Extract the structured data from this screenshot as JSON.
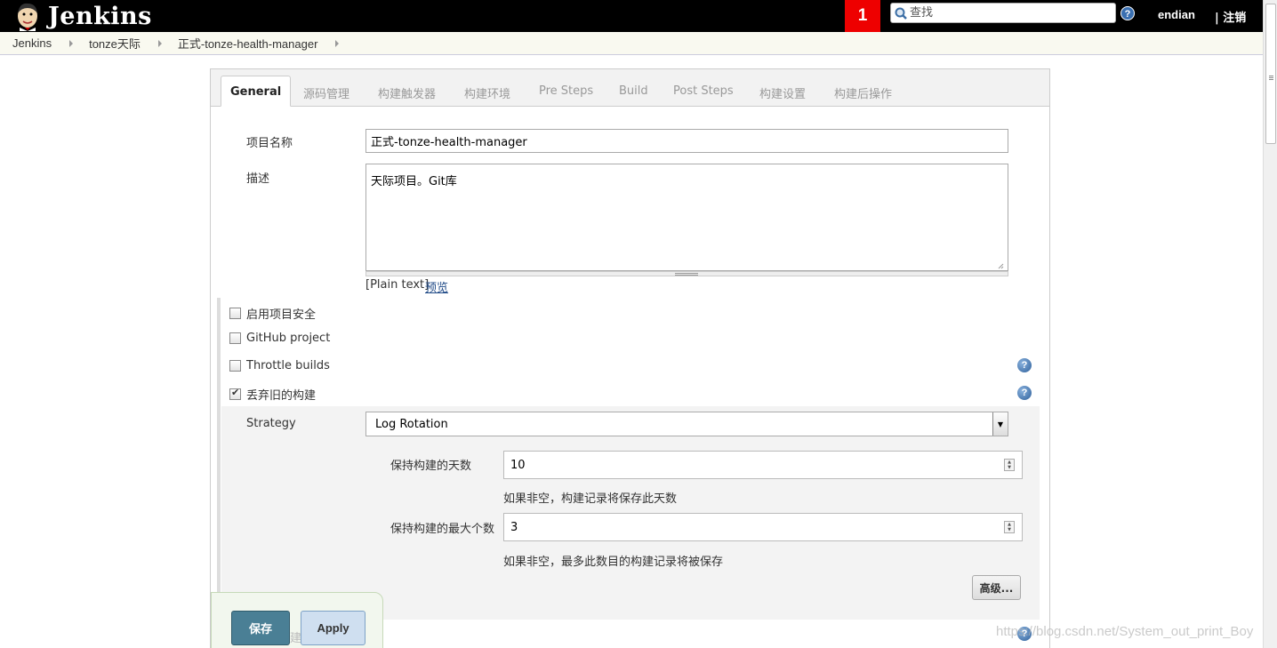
{
  "header": {
    "logo_text": "Jenkins",
    "notification_count": "1",
    "search_placeholder": "查找",
    "username": "endian",
    "logout_label": "| 注销"
  },
  "breadcrumb": [
    "Jenkins",
    "tonze天际",
    "正式-tonze-health-manager"
  ],
  "tabs": [
    "General",
    "源码管理",
    "构建触发器",
    "构建环境",
    "Pre Steps",
    "Build",
    "Post Steps",
    "构建设置",
    "构建后操作"
  ],
  "general": {
    "project_name_label": "项目名称",
    "project_name_value": "正式-tonze-health-manager",
    "description_label": "描述",
    "description_value": "天际项目。Git库",
    "format_label": "[Plain text]",
    "preview_link": "预览"
  },
  "options": [
    {
      "label": "启用项目安全",
      "checked": false
    },
    {
      "label": "GitHub project",
      "checked": false
    },
    {
      "label": "Throttle builds",
      "checked": false
    },
    {
      "label": "丢弃旧的构建",
      "checked": true
    }
  ],
  "discard": {
    "strategy_label": "Strategy",
    "strategy_value": "Log Rotation",
    "days_label": "保持构建的天数",
    "days_value": "10",
    "days_hint": "如果非空，构建记录将保存此天数",
    "max_label": "保持构建的最大个数",
    "max_value": "3",
    "max_hint": "如果非空，最多此数目的构建记录将被保存",
    "advanced_label": "高级..."
  },
  "footer": {
    "save_label": "保存",
    "apply_label": "Apply",
    "hidden_text": "建"
  },
  "watermark": "https://blog.csdn.net/System_out_print_Boy",
  "colors": {
    "header_bg": "#000000",
    "notification_bg": "#ee0000",
    "save_bg": "#4a7f95",
    "apply_bg": "#cfdff0",
    "link": "#204a87"
  }
}
